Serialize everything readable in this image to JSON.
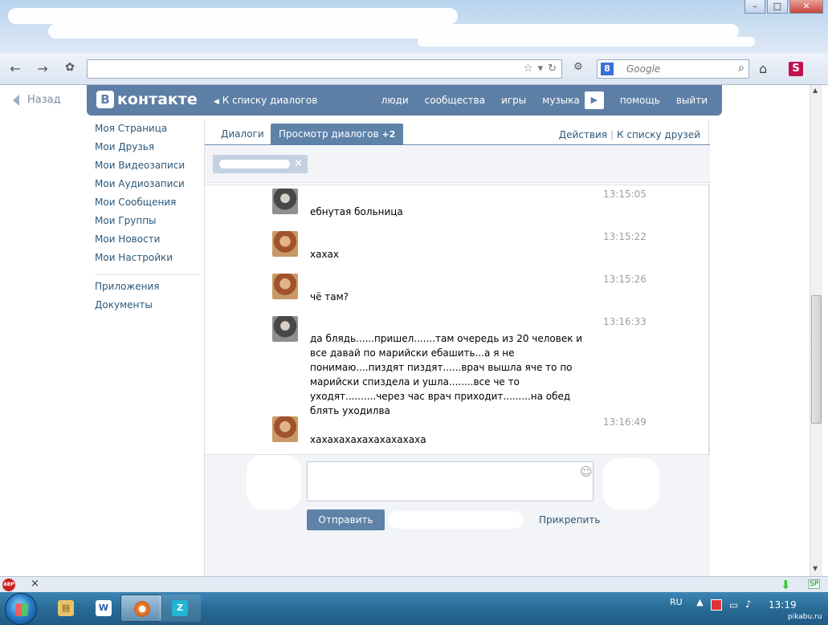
{
  "browser": {
    "search_placeholder": "Google",
    "search_engine_letter": "8",
    "addon_label": "ABP",
    "sp_label": "SP",
    "s_label": "S",
    "window_buttons": {
      "minimize": "–",
      "maximize": "□",
      "close": "✕"
    }
  },
  "page": {
    "back_label": "Назад"
  },
  "vk": {
    "logo_letter": "В",
    "logo_text": "контакте",
    "back_to_dialogs": "К списку диалогов",
    "menu": [
      "люди",
      "сообщества",
      "игры",
      "музыка",
      "помощь",
      "выйти"
    ],
    "left_menu": [
      "Моя Страница",
      "Мои Друзья",
      "Мои Видеозаписи",
      "Мои Аудиозаписи",
      "Мои Сообщения",
      "Мои Группы",
      "Мои Новости",
      "Мои Настройки"
    ],
    "left_menu_extra": [
      "Приложения",
      "Документы"
    ],
    "tabs": {
      "dialogs": "Диалоги",
      "view": "Просмотр диалогов",
      "view_count": "+2"
    },
    "actions": "Действия",
    "friends_link": "К списку друзей",
    "messages": [
      {
        "time": "13:15:05",
        "text": "ебнутая больница",
        "avatar": "dark"
      },
      {
        "time": "13:15:22",
        "text": "хахах",
        "avatar": "light"
      },
      {
        "time": "13:15:26",
        "text": "чё там?",
        "avatar": "light"
      },
      {
        "time": "13:16:33",
        "text": "да блядь......пришел.......там очередь из 20 человек и все давай по марийски ебашить...а я не понимаю....пиздят пиздят......врач вышла яче то по марийски спиздела и ушла........все че то уходят..........через час врач приходит.........на обед блять уходилва",
        "avatar": "dark"
      },
      {
        "time": "13:16:49",
        "text": "хахахахахахахахахаха",
        "avatar": "light"
      }
    ],
    "send_button": "Отправить",
    "attach_link": "Прикрепить"
  },
  "taskbar": {
    "lang": "RU",
    "clock": "13:19",
    "watermark": "pikabu.ru"
  },
  "colors": {
    "vk_blue": "#5d7fa5",
    "link": "#2b587a"
  }
}
